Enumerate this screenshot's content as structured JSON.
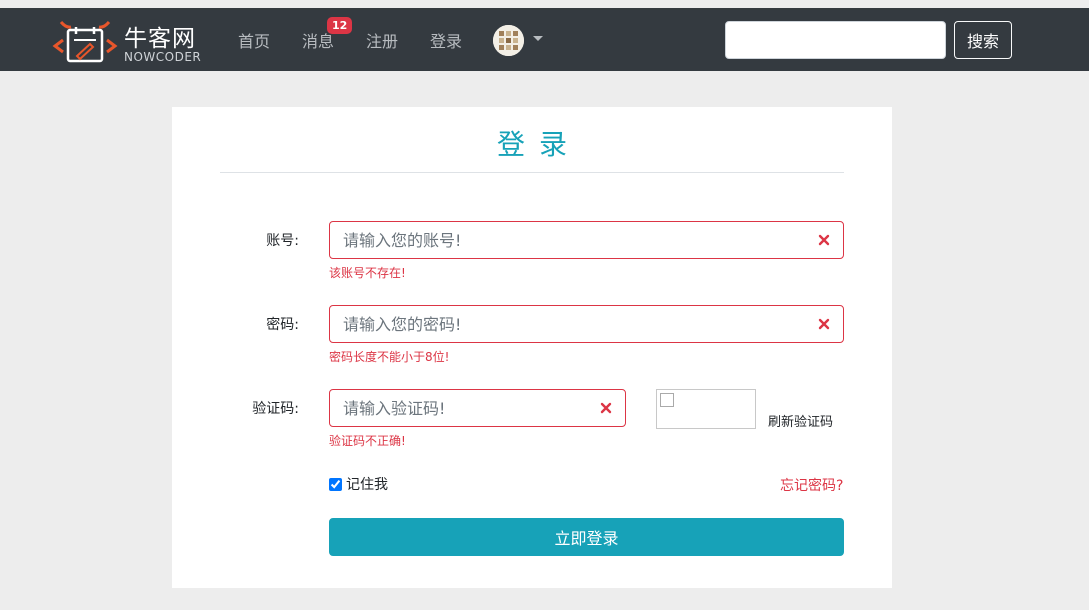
{
  "header": {
    "logo_cn": "牛客网",
    "logo_en": "NOWCODER",
    "nav": {
      "home": "首页",
      "messages": "消息",
      "messages_badge": "12",
      "register": "注册",
      "login": "登录"
    },
    "search": {
      "placeholder": "",
      "button": "搜索"
    }
  },
  "login": {
    "title": "登录",
    "fields": {
      "account": {
        "label": "账号:",
        "placeholder": "请输入您的账号!",
        "error": "该账号不存在!"
      },
      "password": {
        "label": "密码:",
        "placeholder": "请输入您的密码!",
        "error": "密码长度不能小于8位!"
      },
      "captcha": {
        "label": "验证码:",
        "placeholder": "请输入验证码!",
        "error": "验证码不正确!",
        "refresh": "刷新验证码"
      }
    },
    "remember_me": "记住我",
    "remember_checked": true,
    "forgot": "忘记密码?",
    "submit": "立即登录"
  },
  "colors": {
    "navbar": "#343a40",
    "accent": "#17a2b8",
    "error": "#dc3545",
    "badge": "#dc3545",
    "page_bg": "#ededed"
  }
}
